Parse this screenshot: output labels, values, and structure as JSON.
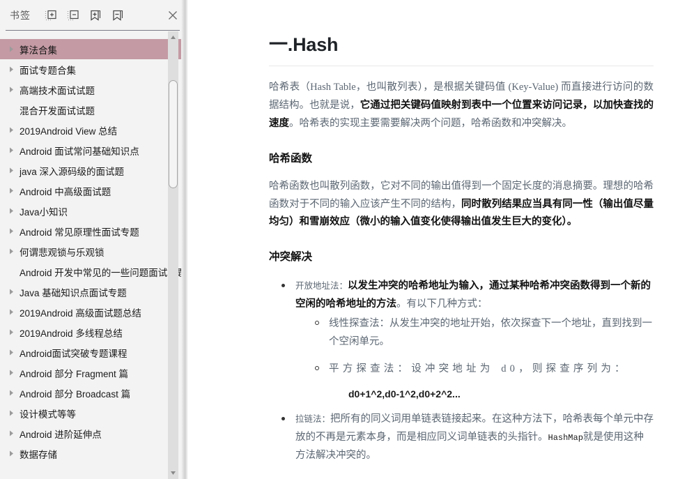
{
  "panel": {
    "title": "书签",
    "tools": [
      {
        "name": "expand-all-icon",
        "label": "展开全部"
      },
      {
        "name": "collapse-all-icon",
        "label": "折叠全部"
      },
      {
        "name": "add-bookmark-icon",
        "label": "添加书签"
      },
      {
        "name": "remove-bookmark-icon",
        "label": "删除书签"
      }
    ],
    "close_label": "关闭",
    "highlight_color": "#c49aa4",
    "items": [
      {
        "label": "算法合集",
        "expandable": true,
        "selected": true
      },
      {
        "label": "面试专题合集",
        "expandable": true,
        "selected": false
      },
      {
        "label": "高端技术面试试题",
        "expandable": true,
        "selected": false
      },
      {
        "label": "混合开发面试试题",
        "expandable": false,
        "selected": false
      },
      {
        "label": "2019Android View 总结",
        "expandable": true,
        "selected": false
      },
      {
        "label": "Android 面试常问基础知识点",
        "expandable": true,
        "selected": false
      },
      {
        "label": "java 深入源码级的面试题",
        "expandable": true,
        "selected": false
      },
      {
        "label": "Android 中高级面试题",
        "expandable": true,
        "selected": false
      },
      {
        "label": "Java小知识",
        "expandable": true,
        "selected": false
      },
      {
        "label": "Android 常见原理性面试专题",
        "expandable": true,
        "selected": false
      },
      {
        "label": "何谓悲观锁与乐观锁",
        "expandable": true,
        "selected": false
      },
      {
        "label": "Android 开发中常见的一些问题面试专题",
        "expandable": false,
        "selected": false
      },
      {
        "label": "Java 基础知识点面试专题",
        "expandable": true,
        "selected": false
      },
      {
        "label": "2019Android 高级面试题总结",
        "expandable": true,
        "selected": false
      },
      {
        "label": "2019Android 多线程总结",
        "expandable": true,
        "selected": false
      },
      {
        "label": "Android面试突破专题课程",
        "expandable": true,
        "selected": false
      },
      {
        "label": "Android 部分 Fragment 篇",
        "expandable": true,
        "selected": false
      },
      {
        "label": "Android 部分 Broadcast 篇",
        "expandable": true,
        "selected": false
      },
      {
        "label": "设计模式等等",
        "expandable": true,
        "selected": false
      },
      {
        "label": "Android 进阶延伸点",
        "expandable": true,
        "selected": false
      },
      {
        "label": "数据存储",
        "expandable": true,
        "selected": false
      }
    ]
  },
  "document": {
    "heading": "一.Hash",
    "intro": {
      "part1": "哈希表（Hash Table，也叫散列表），是根据关键码值 (Key-Value) 而直接进行访问的数据结构。也就是说，",
      "bold1": "它通过把关键码值映射到表中一个位置来访问记录，以加快查找的速度",
      "part2": "。哈希表的实现主要需要解决两个问题，哈希函数和冲突解决。"
    },
    "section_hash_function": {
      "heading": "哈希函数",
      "part1": "哈希函数也叫散列函数，它对不同的输出值得到一个固定长度的消息摘要。理想的哈希函数对于不同的输入应该产生不同的结构，",
      "bold1": "同时散列结果应当具有同一性（输出值尽量均匀）和雪崩效应（微小的输入值变化使得输出值发生巨大的变化）。"
    },
    "section_collision": {
      "heading": "冲突解决",
      "bullets": [
        {
          "lead": "开放地址法：",
          "bold": "以发生冲突的哈希地址为输入，通过某种哈希冲突函数得到一个新的空闲的哈希地址的方法",
          "tail": "。有以下几种方式：",
          "sub": [
            {
              "text": "线性探查法：从发生冲突的地址开始，依次探查下一个地址，直到找到一个空闲单元。",
              "spaced": false,
              "formula": ""
            },
            {
              "text": "平方探查法：设冲突地址为 d0，则探查序列为：",
              "spaced": true,
              "formula": "d0+1^2,d0-1^2,d0+2^2..."
            }
          ]
        },
        {
          "lead": "拉链法：",
          "bold": "",
          "tail": "把所有的同义词用单链表链接起来。在这种方法下，哈希表每个单元中存放的不再是元素本身，而是相应同义词单链表的头指针。",
          "code": "HashMap",
          "tail2": "就是使用这种方法解决冲突的。",
          "sub": []
        }
      ]
    }
  }
}
